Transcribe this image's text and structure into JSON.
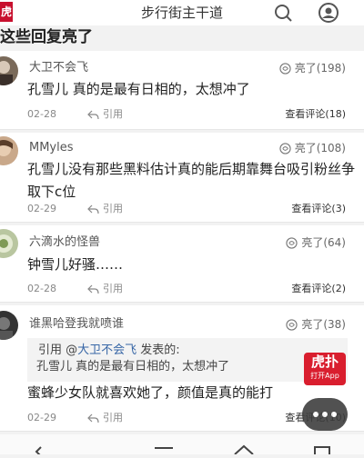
{
  "header": {
    "logo_text": "虎扑",
    "title": "步行街主干道"
  },
  "section": {
    "title": "这些回复亮了"
  },
  "comments": [
    {
      "username": "大卫不会飞",
      "likes": "亮了(198)",
      "content": "孔雪儿 真的是最有日相的，太想冲了",
      "date": "02-28",
      "reply_label": "引用",
      "view_label": "查看评论(18)"
    },
    {
      "username": "MMyles",
      "likes": "亮了(108)",
      "content": "孔雪儿没有那些黑料估计真的能后期靠舞台吸引粉丝争取下c位",
      "date": "02-29",
      "reply_label": "引用",
      "view_label": "查看评论(3)"
    },
    {
      "username": "六滴水的怪兽",
      "likes": "亮了(64)",
      "content": "钟雪儿好骚……",
      "date": "02-28",
      "reply_label": "引用",
      "view_label": "查看评论(2)"
    },
    {
      "username": "谁黑哈登我就喷谁",
      "likes": "亮了(38)",
      "quote_prefix": "引用 @",
      "quote_user": "大卫不会飞",
      "quote_suffix": " 发表的:",
      "quote_text": "孔雪儿 真的是最有日相的，太想冲了",
      "content": "蜜蜂少女队就喜欢她了，颜值是真的能打",
      "date": "02-29",
      "reply_label": "引用",
      "view_label": "查看评论(10)"
    }
  ],
  "app_badge": {
    "glyph": "虎扑",
    "label": "打开App"
  },
  "colors": {
    "brand_red": "#c8102e",
    "link_blue": "#3766a6"
  }
}
